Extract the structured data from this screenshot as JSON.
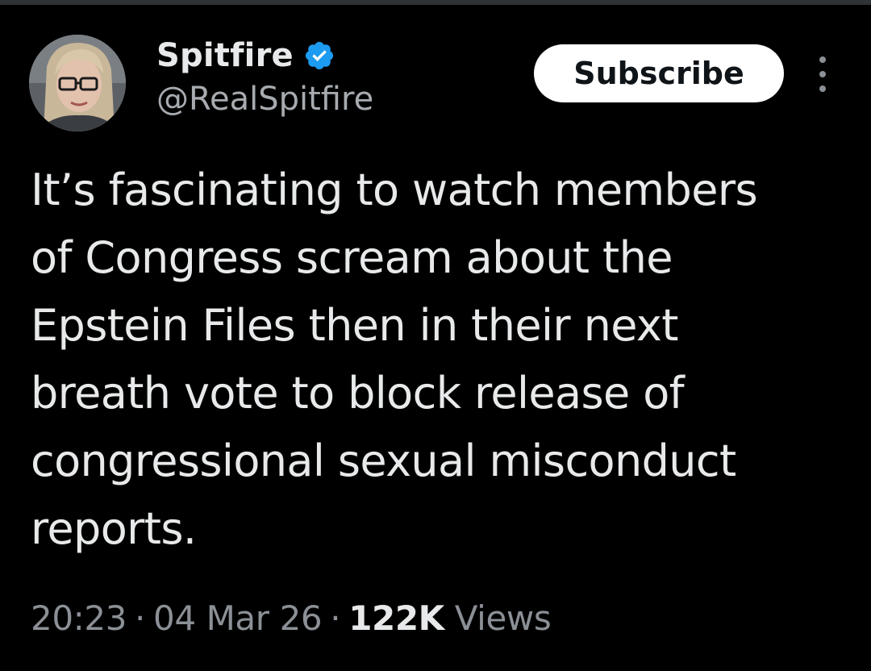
{
  "author": {
    "display_name": "Spitfire",
    "handle": "@RealSpitfire",
    "verified": true,
    "verified_icon": "verified-badge-icon",
    "verified_color": "#1d9bf0"
  },
  "actions": {
    "subscribe_label": "Subscribe",
    "more_icon": "more-vertical-icon"
  },
  "tweet": {
    "text": "It’s fascinating to watch members\nof Congress scream about the\nEpstein Files then in their next\nbreath vote to block release of\ncongressional sexual misconduct\nreports."
  },
  "meta": {
    "time": "20:23",
    "separator": "·",
    "date": "04 Mar 26",
    "views_count": "122K",
    "views_label": "Views"
  },
  "colors": {
    "background": "#000000",
    "text_primary": "#e7e9ea",
    "text_secondary": "#8b9096",
    "button_bg": "#ffffff",
    "button_text": "#0f1419"
  }
}
